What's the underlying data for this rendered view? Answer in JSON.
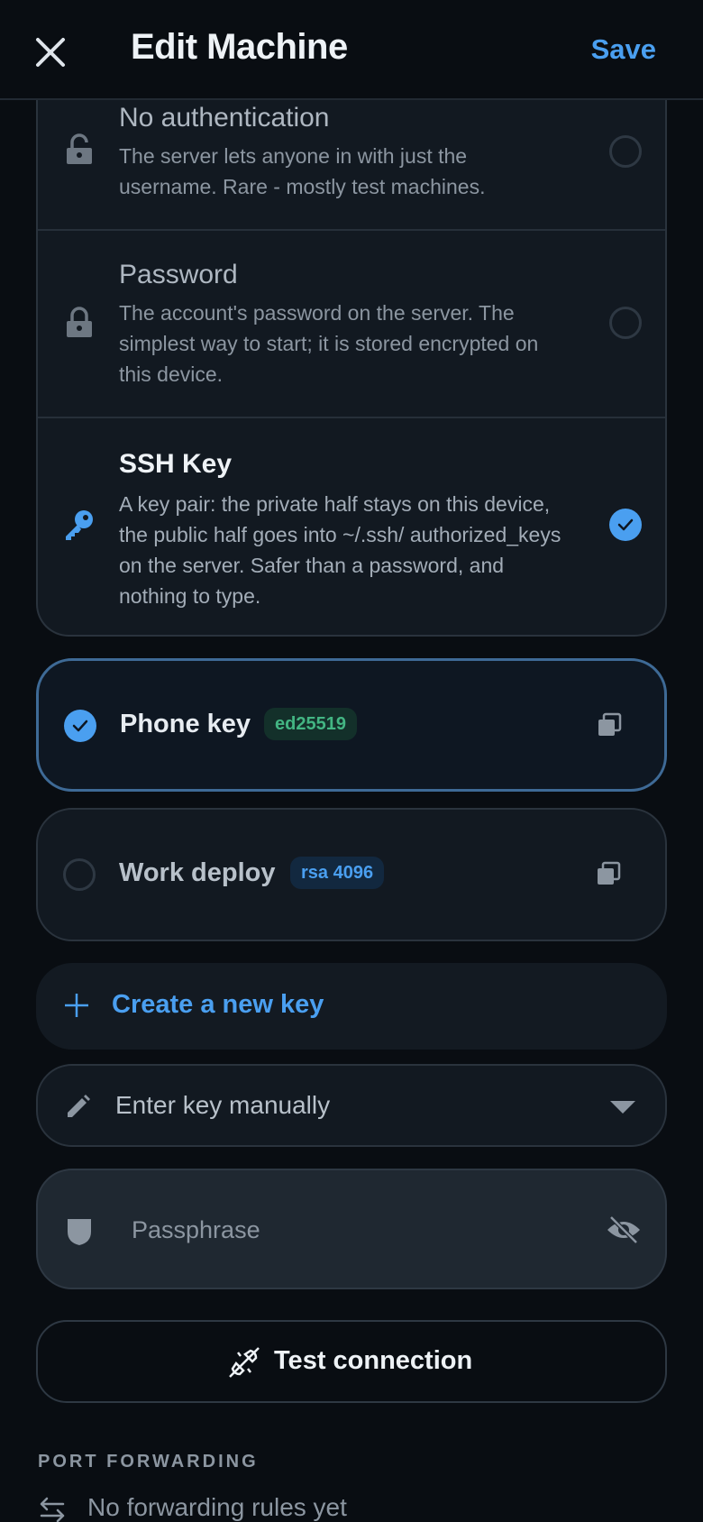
{
  "header": {
    "title": "Edit Machine",
    "save_label": "Save"
  },
  "auth": {
    "options": [
      {
        "title": "No authentication",
        "description": "The server lets anyone in with just the username. Rare - mostly test machines.",
        "icon": "lock-open-icon",
        "selected": false
      },
      {
        "title": "Password",
        "description": "The account's password on the server. The simplest way to start; it is stored encrypted on this device.",
        "icon": "lock-icon",
        "selected": false
      },
      {
        "title": "SSH Key",
        "description": "A key pair: the private half stays on this device, the public half goes into ~/.ssh/ authorized_keys on the server. Safer than a password, and nothing to type.",
        "icon": "key-icon",
        "selected": true
      }
    ]
  },
  "keys": [
    {
      "name": "Phone key",
      "type": "ed25519",
      "selected": true
    },
    {
      "name": "Work deploy",
      "type": "rsa 4096",
      "selected": false
    }
  ],
  "create_key_label": "Create a new key",
  "manual_key_label": "Enter key manually",
  "passphrase": {
    "placeholder": "Passphrase",
    "value": ""
  },
  "test_connection_label": "Test connection",
  "port_forwarding": {
    "heading": "PORT FORWARDING",
    "empty_text": "No forwarding rules yet"
  },
  "colors": {
    "accent": "#4a9ff0",
    "background": "#090d12",
    "card": "#121921",
    "badge_green": "#43b583"
  }
}
